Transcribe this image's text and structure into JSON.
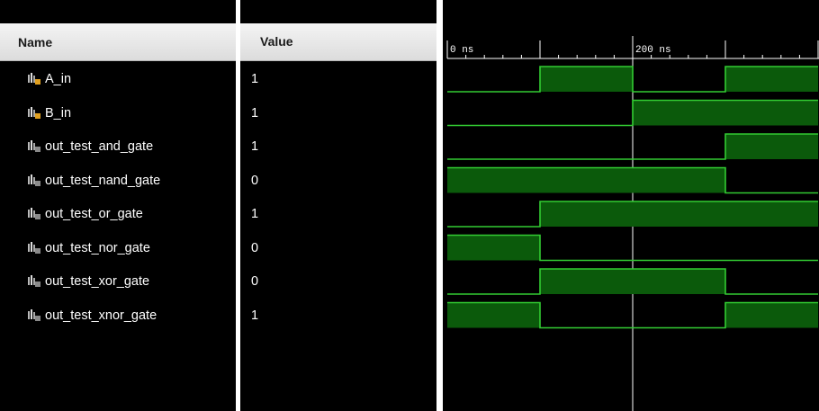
{
  "columns": {
    "name": "Name",
    "value": "Value"
  },
  "signals": [
    {
      "name": "A_in",
      "value": "1",
      "kind": "input"
    },
    {
      "name": "B_in",
      "value": "1",
      "kind": "input"
    },
    {
      "name": "out_test_and_gate",
      "value": "1",
      "kind": "output"
    },
    {
      "name": "out_test_nand_gate",
      "value": "0",
      "kind": "output"
    },
    {
      "name": "out_test_or_gate",
      "value": "1",
      "kind": "output"
    },
    {
      "name": "out_test_nor_gate",
      "value": "0",
      "kind": "output"
    },
    {
      "name": "out_test_xor_gate",
      "value": "0",
      "kind": "output"
    },
    {
      "name": "out_test_xnor_gate",
      "value": "1",
      "kind": "output"
    }
  ],
  "timeline": {
    "unit": "ns",
    "labels": [
      {
        "time": 0,
        "text": "0 ns"
      },
      {
        "time": 200,
        "text": "200 ns"
      }
    ],
    "visible_start_ns": 0,
    "visible_end_ns": 400,
    "cursor_ns": 200
  },
  "waveforms": [
    {
      "signal": "A_in",
      "segments": [
        [
          0,
          100,
          0
        ],
        [
          100,
          200,
          1
        ],
        [
          200,
          300,
          0
        ],
        [
          300,
          400,
          1
        ]
      ]
    },
    {
      "signal": "B_in",
      "segments": [
        [
          0,
          200,
          0
        ],
        [
          200,
          400,
          1
        ]
      ]
    },
    {
      "signal": "out_test_and_gate",
      "segments": [
        [
          0,
          300,
          0
        ],
        [
          300,
          400,
          1
        ]
      ]
    },
    {
      "signal": "out_test_nand_gate",
      "segments": [
        [
          0,
          300,
          1
        ],
        [
          300,
          400,
          0
        ]
      ]
    },
    {
      "signal": "out_test_or_gate",
      "segments": [
        [
          0,
          100,
          0
        ],
        [
          100,
          400,
          1
        ]
      ]
    },
    {
      "signal": "out_test_nor_gate",
      "segments": [
        [
          0,
          100,
          1
        ],
        [
          100,
          400,
          0
        ]
      ]
    },
    {
      "signal": "out_test_xor_gate",
      "segments": [
        [
          0,
          100,
          0
        ],
        [
          100,
          300,
          1
        ],
        [
          300,
          400,
          0
        ]
      ]
    },
    {
      "signal": "out_test_xnor_gate",
      "segments": [
        [
          0,
          100,
          1
        ],
        [
          100,
          300,
          0
        ],
        [
          300,
          400,
          1
        ]
      ]
    }
  ],
  "colors": {
    "wave_line": "#33cc33",
    "wave_fill": "#0b5a0b",
    "cursor": "#ffffff",
    "background": "#000000"
  },
  "icons": {
    "input": "input-port-icon",
    "output": "output-port-icon"
  }
}
